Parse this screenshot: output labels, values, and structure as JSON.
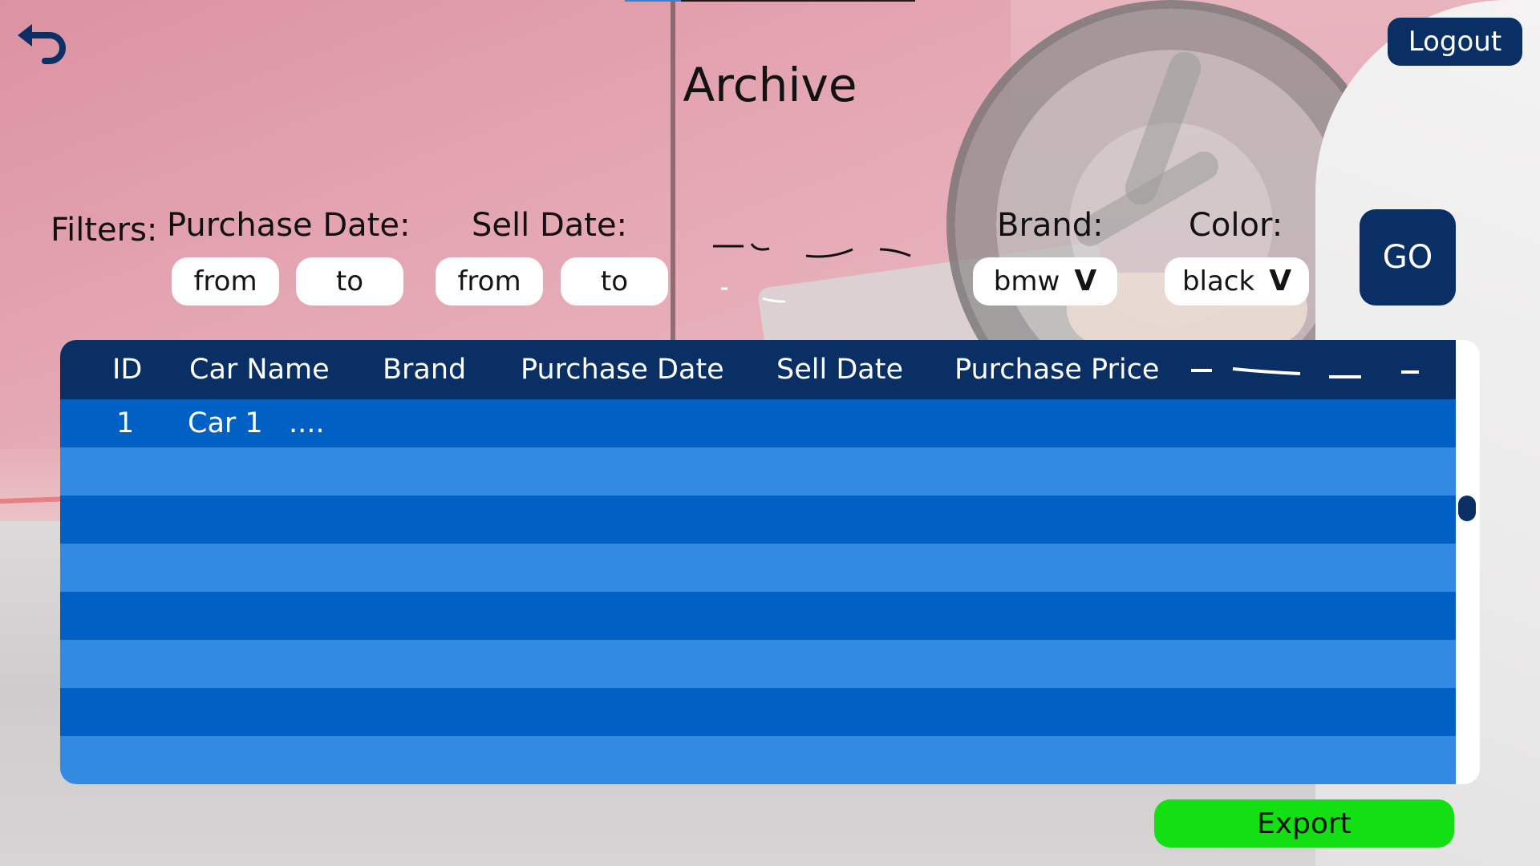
{
  "header": {
    "title": "Archive",
    "logout_label": "Logout",
    "back_icon": "back-arrow-icon"
  },
  "filters": {
    "label": "Filters:",
    "purchase_date": {
      "label": "Purchase Date:",
      "from_label": "from",
      "to_label": "to"
    },
    "sell_date": {
      "label": "Sell Date:",
      "from_label": "from",
      "to_label": "to"
    },
    "brand": {
      "label": "Brand:",
      "value": "bmw",
      "chevron": "V"
    },
    "color": {
      "label": "Color:",
      "value": "black",
      "chevron": "V"
    },
    "go_label": "GO"
  },
  "table": {
    "columns": [
      "ID",
      "Car Name",
      "Brand",
      "Purchase Date",
      "Sell Date",
      "Purchase Price"
    ],
    "rows": [
      {
        "id": "1",
        "car_name": "Car 1",
        "more": "...."
      }
    ],
    "colors": {
      "header": "#0a2f64",
      "row_dark": "#0060c3",
      "row_light": "#338ae3"
    }
  },
  "export_label": "Export",
  "colors": {
    "primary": "#0a2f64",
    "export": "#13e013"
  }
}
